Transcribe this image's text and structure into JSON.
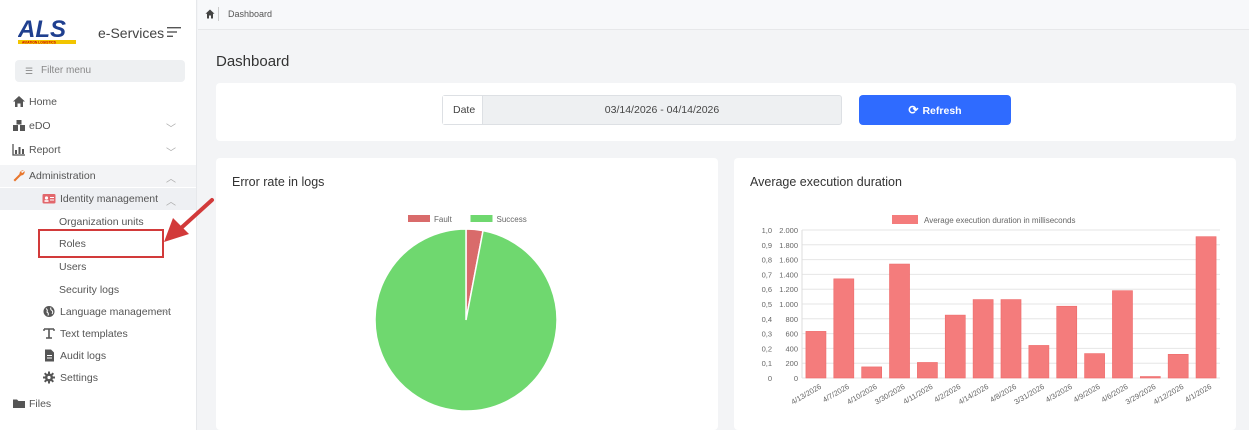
{
  "app": {
    "logo_text": "ALS",
    "logo_subtext": "AVIATION LOGISTICS",
    "title": "e-Services",
    "colors": {
      "accent": "#2f6bff",
      "logo_blue": "#1f3f8f",
      "highlight_red": "#d23a3a"
    }
  },
  "sidebar": {
    "filter_placeholder": "Filter menu",
    "items": [
      {
        "label": "Home",
        "icon": "home-icon"
      },
      {
        "label": "eDO",
        "icon": "edo-icon"
      },
      {
        "label": "Report",
        "icon": "chart-icon"
      },
      {
        "label": "Administration",
        "icon": "wrench-icon"
      }
    ],
    "admin_children": {
      "identity_label": "Identity management",
      "identity_items": [
        "Organization units",
        "Roles",
        "Users",
        "Security logs"
      ],
      "language_label": "Language management",
      "text_templates_label": "Text templates",
      "audit_logs_label": "Audit logs",
      "settings_label": "Settings"
    },
    "files_label": "Files"
  },
  "breadcrumb": {
    "current": "Dashboard"
  },
  "page": {
    "title": "Dashboard"
  },
  "filters": {
    "date_label": "Date",
    "date_range": "03/14/2026 - 04/14/2026",
    "refresh_label": "Refresh"
  },
  "charts": {
    "error_rate_title": "Error rate in logs",
    "avg_duration_title": "Average execution duration"
  },
  "chart_data": [
    {
      "type": "pie",
      "title": "Error rate in logs",
      "labels": [
        "Fault",
        "Success"
      ],
      "values": [
        3,
        97
      ],
      "colors": [
        "#d96b6b",
        "#6fd86f"
      ],
      "legend": "top"
    },
    {
      "type": "bar",
      "title": "Average execution duration",
      "series": [
        {
          "name": "Average execution duration in milliseconds",
          "values": [
            630,
            1340,
            150,
            1540,
            210,
            850,
            1060,
            1060,
            440,
            970,
            330,
            1180,
            20,
            320,
            1910
          ],
          "color": "#f47c7c"
        }
      ],
      "categories": [
        "4/13/2026",
        "4/7/2026",
        "4/10/2026",
        "3/30/2026",
        "4/11/2026",
        "4/2/2026",
        "4/14/2026",
        "4/8/2026",
        "3/31/2026",
        "4/3/2026",
        "4/9/2026",
        "4/6/2026",
        "3/29/2026",
        "4/12/2026",
        "4/1/2026"
      ],
      "ylim": [
        0,
        2000
      ],
      "y_ticks": [
        "0",
        "200",
        "400",
        "600",
        "800",
        "1.000",
        "1.200",
        "1.400",
        "1.600",
        "1.800",
        "2.000"
      ],
      "y2_ticks": [
        "0",
        "0,1",
        "0,2",
        "0,3",
        "0,4",
        "0,5",
        "0,6",
        "0,7",
        "0,8",
        "0,9",
        "1,0"
      ],
      "grid": true,
      "legend": "top"
    }
  ]
}
